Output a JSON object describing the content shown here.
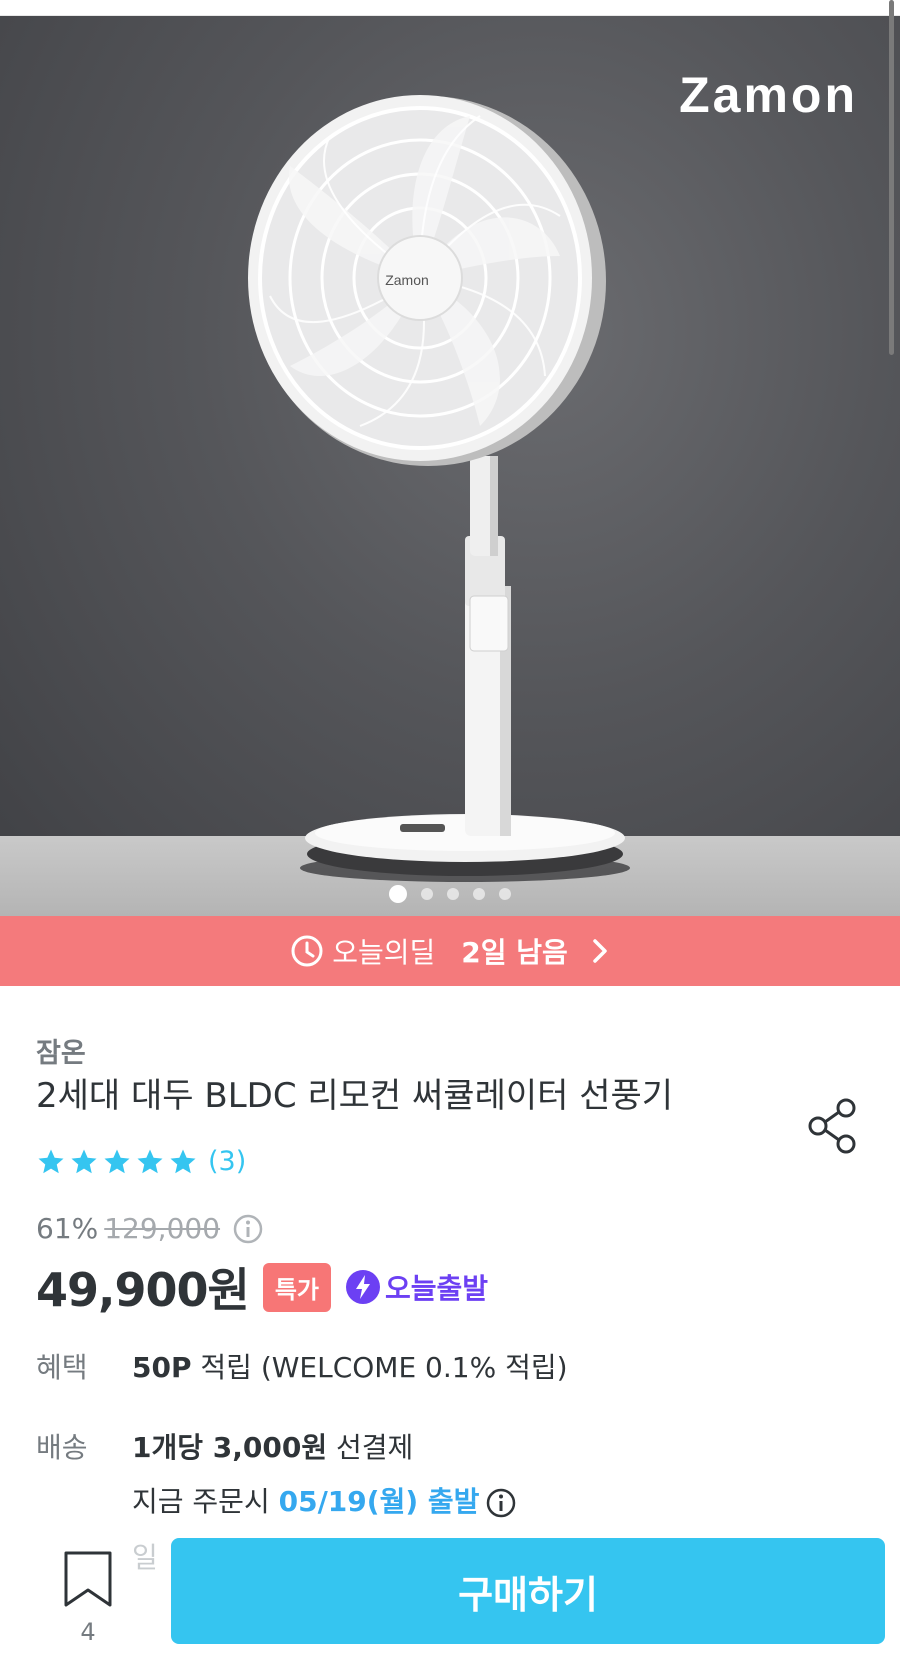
{
  "hero": {
    "brand_logo": "Zamon",
    "fan_logo": "Zamon",
    "carousel_total": 5,
    "carousel_active": 1
  },
  "deal_bar": {
    "label": "오늘의딜",
    "remaining": "2일 남음",
    "icon": "clock-icon",
    "background": "#f47a7c"
  },
  "product": {
    "brand": "잠온",
    "title": "2세대 대두 BLDC 리모컨 써큘레이터 선풍기",
    "rating_stars": 5,
    "review_count": "(3)",
    "discount": "61%",
    "original_price": "129,000",
    "price": "49,900원",
    "badge_special": "특가",
    "badge_today_ship": "오늘출발"
  },
  "details": {
    "benefit_label": "혜택",
    "benefit_points": "50P",
    "benefit_rest": " 적립 (WELCOME 0.1% 적립)",
    "delivery_label": "배송",
    "delivery_fee_bold": "1개당 3,000원",
    "delivery_fee_rest": " 선결제",
    "order_prefix": "지금 주문시 ",
    "order_date": "05/19(월) 출발",
    "faded_text": "일"
  },
  "bottom": {
    "bookmark_count": "4",
    "buy_label": "구매하기"
  },
  "colors": {
    "accent": "#35c5f0",
    "special": "#f77676",
    "today_ship": "#6c40f3"
  }
}
